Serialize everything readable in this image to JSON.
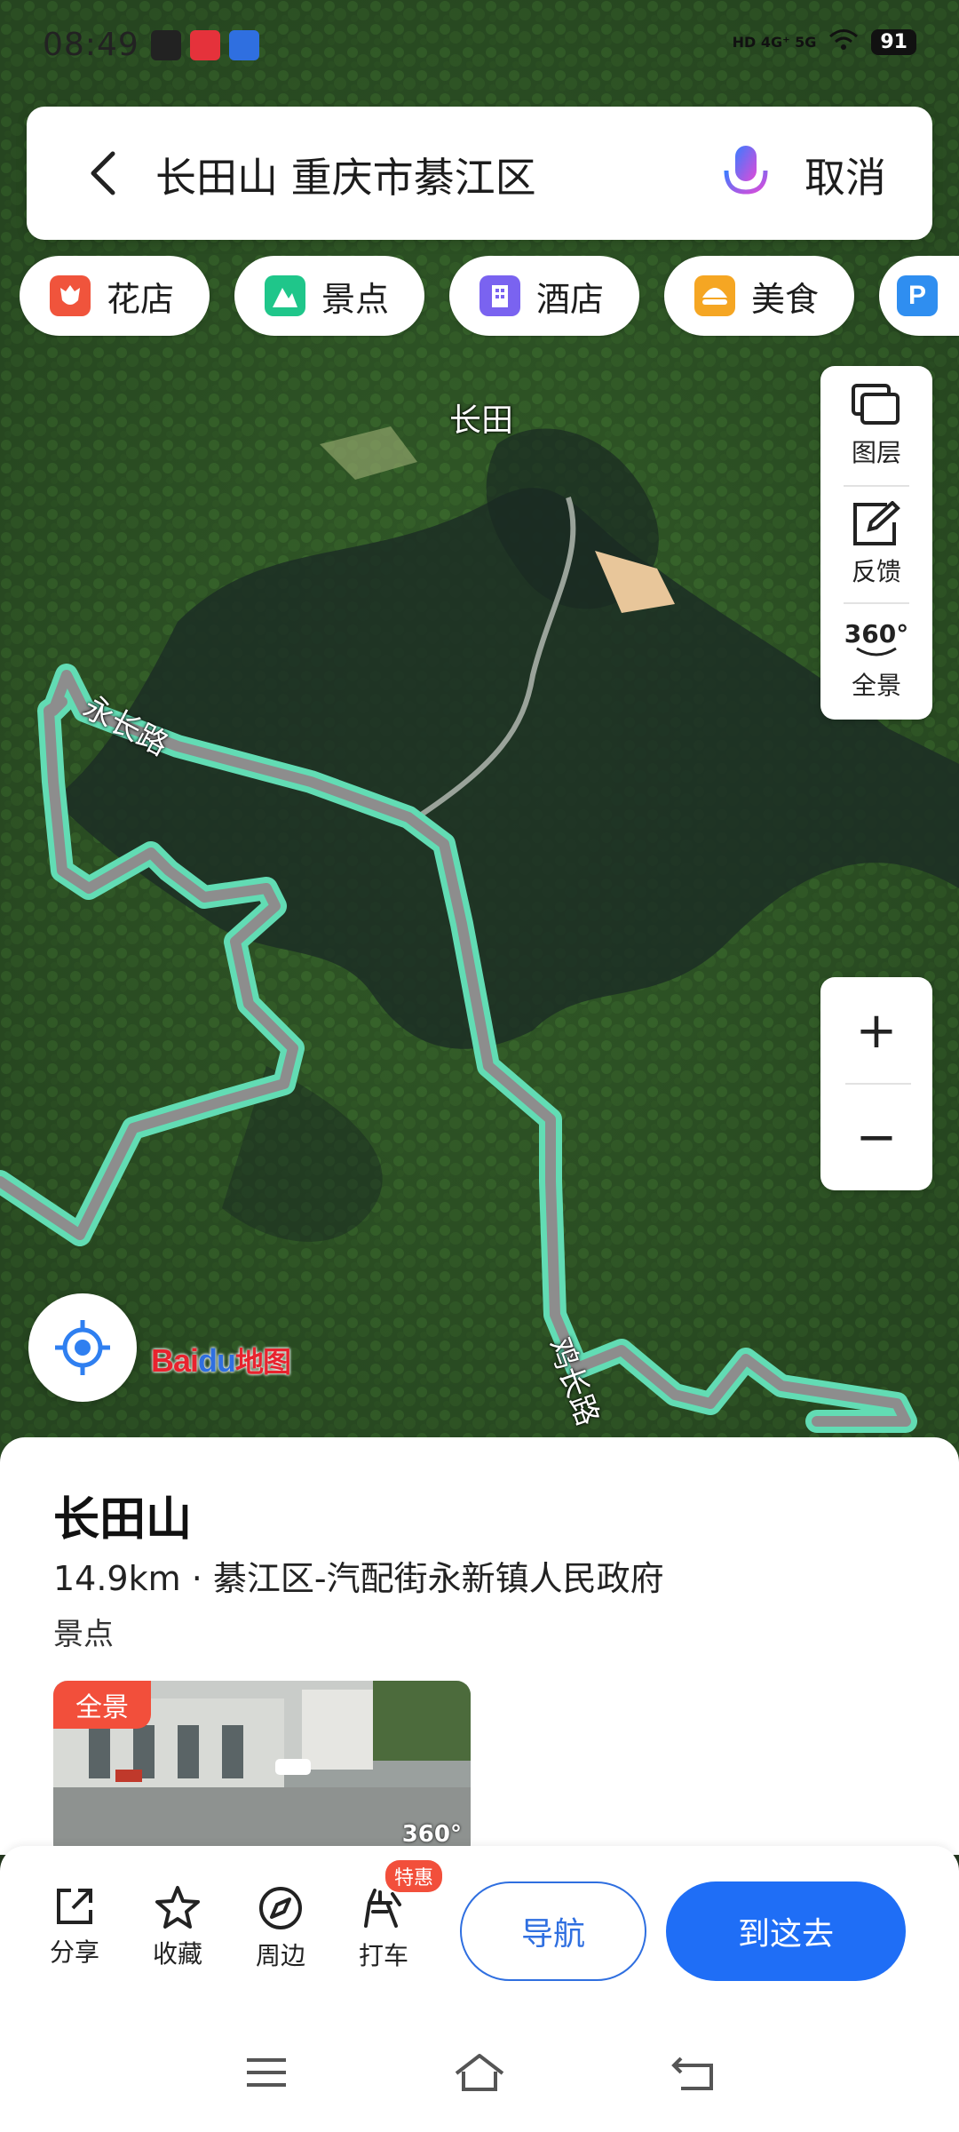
{
  "status_bar": {
    "time": "08:49",
    "network": "HD 4G⁺ 5G",
    "battery": "91"
  },
  "search": {
    "query": "长田山 重庆市綦江区",
    "cancel_label": "取消"
  },
  "categories": [
    {
      "label": "花店",
      "icon": "flower-shop-icon",
      "color": "#f0543c"
    },
    {
      "label": "景点",
      "icon": "scenic-spot-icon",
      "color": "#1fc68a"
    },
    {
      "label": "酒店",
      "icon": "hotel-icon",
      "color": "#7a63f0"
    },
    {
      "label": "美食",
      "icon": "food-icon",
      "color": "#f5a623"
    },
    {
      "label": "",
      "icon": "parking-icon",
      "color": "#2f8ef0"
    }
  ],
  "map": {
    "place_label": "长田",
    "road_labels": [
      "永长路",
      "鸡长路"
    ],
    "route_color": "#62dcb4",
    "logo_text": "Bai du 地图"
  },
  "controls": {
    "layers_label": "图层",
    "feedback_label": "反馈",
    "panorama_label": "全景",
    "panorama_badge": "360°",
    "zoom_in": "+",
    "zoom_out": "−"
  },
  "place": {
    "name": "长田山",
    "meta": "14.9km · 綦江区-汽配街永新镇人民政府",
    "category": "景点",
    "pano_tag": "全景",
    "pano_360": "360°"
  },
  "actions": {
    "share": "分享",
    "favorite": "收藏",
    "nearby": "周边",
    "taxi": "打车",
    "taxi_badge": "特惠",
    "navigate": "导航",
    "go_here": "到这去"
  }
}
